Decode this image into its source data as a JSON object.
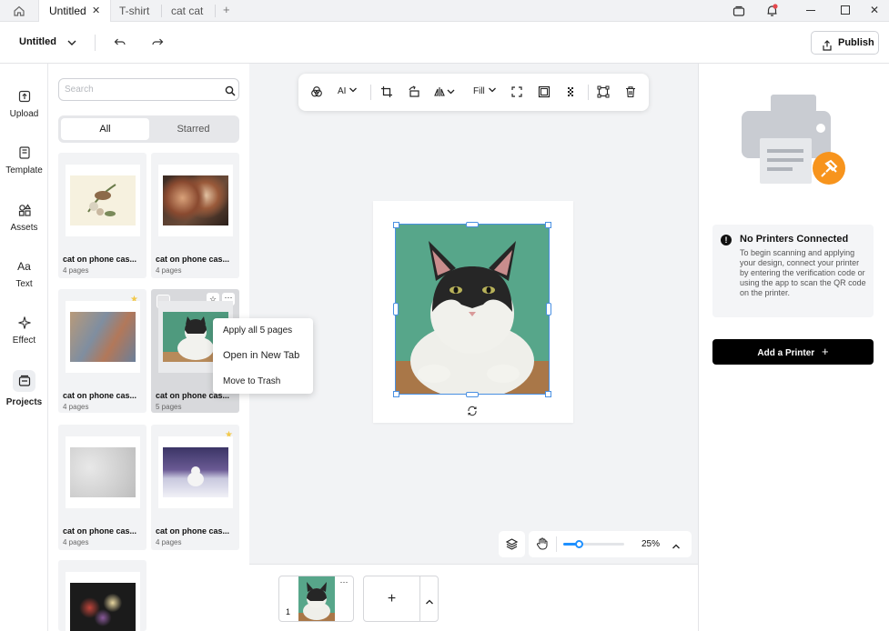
{
  "tabs": [
    {
      "label": "Untitled",
      "active": true
    },
    {
      "label": "T-shirt",
      "active": false
    },
    {
      "label": "cat cat",
      "active": false
    }
  ],
  "header": {
    "doc_title": "Untitled",
    "publish_label": "Publish"
  },
  "rail": [
    {
      "label": "Upload",
      "icon": "upload-icon"
    },
    {
      "label": "Template",
      "icon": "template-icon"
    },
    {
      "label": "Assets",
      "icon": "assets-icon"
    },
    {
      "label": "Text",
      "icon": "text-icon"
    },
    {
      "label": "Effect",
      "icon": "effect-icon"
    },
    {
      "label": "Projects",
      "icon": "projects-icon",
      "active": true
    }
  ],
  "panel": {
    "search_placeholder": "Search",
    "segments": {
      "all": "All",
      "starred": "Starred"
    },
    "projects": [
      {
        "title": "cat on phone cas...",
        "pages": "4 pages",
        "starred": false
      },
      {
        "title": "cat on phone cas...",
        "pages": "4 pages",
        "starred": false
      },
      {
        "title": "cat on phone cas...",
        "pages": "4 pages",
        "starred": true
      },
      {
        "title": "cat on phone cas...",
        "pages": "5 pages",
        "starred": false
      },
      {
        "title": "cat on phone cas...",
        "pages": "4 pages",
        "starred": false
      },
      {
        "title": "cat on phone cas...",
        "pages": "4 pages",
        "starred": true
      }
    ]
  },
  "context_menu": [
    "Apply all 5 pages",
    "Open in New Tab",
    "Move to Trash"
  ],
  "toolbar": {
    "ai_label": "AI",
    "fill_label": "Fill"
  },
  "zoom": {
    "level": "25%",
    "fraction": 0.25
  },
  "pages_strip": {
    "page_number": "1"
  },
  "right_panel": {
    "status_title": "No Printers Connected",
    "status_body": "To begin scanning and applying your design, connect your printer by entering the verification code or using the app to scan the QR code on the printer.",
    "add_printer_label": "Add a Printer"
  },
  "colors": {
    "accent": "#f7941d",
    "selection": "#4a90e2",
    "notification": "#e5484d"
  }
}
